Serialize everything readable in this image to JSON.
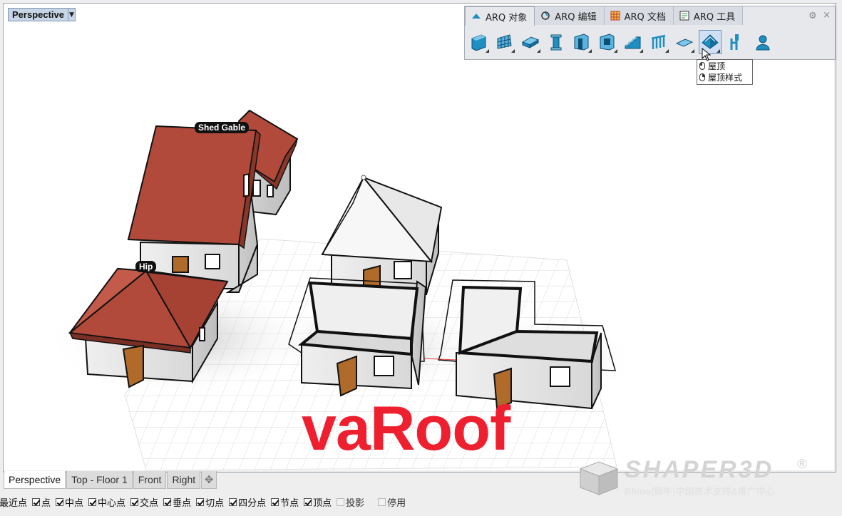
{
  "viewport": {
    "title": "Perspective",
    "dropdown_arrow": "▼",
    "labels": {
      "shed_gable": "Shed Gable",
      "hip": "Hip"
    },
    "watermark": "vaRoof"
  },
  "toolbar_panel": {
    "tabs": [
      {
        "label": "ARQ 对象",
        "icon": "roof-object-icon",
        "active": true
      },
      {
        "label": "ARQ 编辑",
        "icon": "edit-icon",
        "active": false
      },
      {
        "label": "ARQ 文档",
        "icon": "document-grid-icon",
        "active": false
      },
      {
        "label": "ARQ 工具",
        "icon": "tools-icon",
        "active": false
      }
    ],
    "gear": "⚙",
    "close": "×",
    "buttons": [
      {
        "name": "wall-icon"
      },
      {
        "name": "curtain-wall-icon"
      },
      {
        "name": "slab-icon"
      },
      {
        "name": "column-icon"
      },
      {
        "name": "door-icon"
      },
      {
        "name": "window-icon"
      },
      {
        "name": "stair-icon"
      },
      {
        "name": "railing-icon"
      },
      {
        "name": "plane-icon"
      },
      {
        "name": "roof-icon",
        "hover": true
      },
      {
        "name": "furniture-icon"
      },
      {
        "name": "annotation-icon"
      }
    ],
    "tooltip": {
      "left_click": "屋顶",
      "right_click": "屋顶样式"
    }
  },
  "view_tabs": [
    "Perspective",
    "Top - Floor 1",
    "Front",
    "Right"
  ],
  "view_tab_add": "✥",
  "osnaps": [
    {
      "label": "最近点",
      "checked": true
    },
    {
      "label": "点",
      "checked": true
    },
    {
      "label": "中点",
      "checked": true
    },
    {
      "label": "中心点",
      "checked": true
    },
    {
      "label": "交点",
      "checked": true
    },
    {
      "label": "垂点",
      "checked": true
    },
    {
      "label": "切点",
      "checked": true
    },
    {
      "label": "四分点",
      "checked": true
    },
    {
      "label": "节点",
      "checked": true
    },
    {
      "label": "顶点",
      "checked": true
    },
    {
      "label": "投影",
      "checked": false
    },
    {
      "label": "停用",
      "checked": false
    }
  ],
  "brand": {
    "name": "SHAPER3D",
    "registered": "®",
    "subtitle": "Rhino(犀牛)中国技术支持&推广中心"
  },
  "colors": {
    "roof": "#b24a3c",
    "door": "#b06a2a",
    "accent": "#1f8fc2",
    "watermark": "#ee2030"
  }
}
